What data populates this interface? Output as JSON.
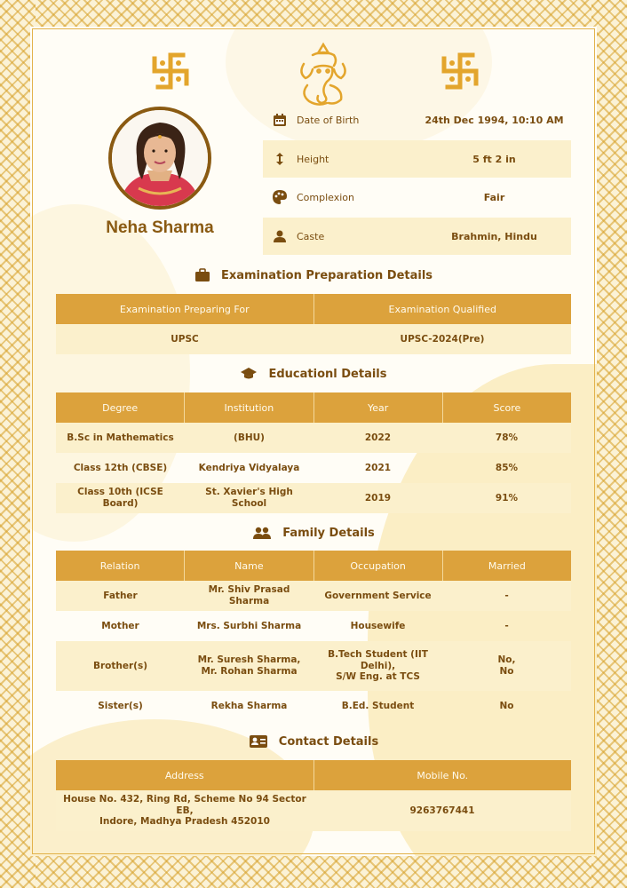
{
  "profile": {
    "name": "Neha Sharma",
    "info": [
      {
        "icon": "calendar-icon",
        "label": "Date of Birth",
        "value": "24th Dec 1994, 10:10 AM"
      },
      {
        "icon": "height-arrow-icon",
        "label": "Height",
        "value": "5 ft 2 in"
      },
      {
        "icon": "palette-icon",
        "label": "Complexion",
        "value": "Fair"
      },
      {
        "icon": "person-icon",
        "label": "Caste",
        "value": "Brahmin, Hindu"
      }
    ]
  },
  "exam": {
    "title": "Examination Preparation Details",
    "headers": [
      "Examination Preparing For",
      "Examination Qualified"
    ],
    "rows": [
      [
        "UPSC",
        "UPSC-2024(Pre)"
      ]
    ]
  },
  "education": {
    "title": "Educationl Details",
    "headers": [
      "Degree",
      "Institution",
      "Year",
      "Score"
    ],
    "rows": [
      [
        "B.Sc in Mathematics",
        "(BHU)",
        "2022",
        "78%"
      ],
      [
        "Class 12th (CBSE)",
        "Kendriya Vidyalaya",
        "2021",
        "85%"
      ],
      [
        "Class 10th (ICSE Board)",
        "St. Xavier's High School",
        "2019",
        "91%"
      ]
    ]
  },
  "family": {
    "title": "Family Details",
    "headers": [
      "Relation",
      "Name",
      "Occupation",
      "Married"
    ],
    "rows": [
      [
        "Father",
        "Mr. Shiv Prasad Sharma",
        "Government Service",
        "-"
      ],
      [
        "Mother",
        "Mrs. Surbhi Sharma",
        "Housewife",
        "-"
      ],
      [
        "Brother(s)",
        "Mr. Suresh Sharma,\nMr. Rohan Sharma",
        "B.Tech Student (IIT\nDelhi),\nS/W Eng. at TCS",
        "No,\nNo"
      ],
      [
        "Sister(s)",
        "Rekha Sharma",
        "B.Ed. Student",
        "No"
      ]
    ]
  },
  "contact": {
    "title": "Contact Details",
    "headers": [
      "Address",
      "Mobile No."
    ],
    "rows": [
      [
        "House No. 432, Ring Rd, Scheme No 94 Sector EB,\nIndore, Madhya Pradesh 452010",
        "9263767441"
      ]
    ]
  },
  "colors": {
    "accent": "#dca23c",
    "text": "#7a4d10",
    "row_shade": "#fbf0cc"
  }
}
